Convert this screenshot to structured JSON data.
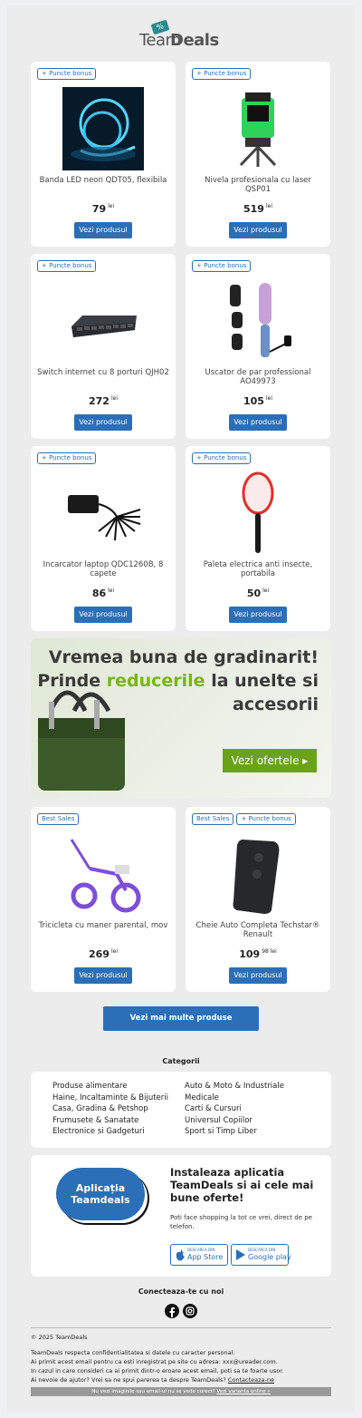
{
  "logo": {
    "brand_a": "Team",
    "brand_b": "Deals",
    "tag": "%"
  },
  "products": [
    {
      "badges": [
        "+ Puncte bonus"
      ],
      "name": "Banda LED neon QDT05, flexibila",
      "price": "79",
      "cents": "",
      "currency": "lei",
      "button": "Vezi produsul"
    },
    {
      "badges": [
        "+ Puncte bonus"
      ],
      "name": "Nivela profesionala cu laser QSP01",
      "price": "519",
      "cents": "",
      "currency": "lei",
      "button": "Vezi produsul"
    },
    {
      "badges": [
        "+ Puncte bonus"
      ],
      "name": "Switch internet cu 8 porturi QJH02",
      "price": "272",
      "cents": "",
      "currency": "lei",
      "button": "Vezi produsul"
    },
    {
      "badges": [
        "+ Puncte bonus"
      ],
      "name": "Uscator de par professional AO49973",
      "price": "105",
      "cents": "",
      "currency": "lei",
      "button": "Vezi produsul"
    },
    {
      "badges": [
        "+ Puncte bonus"
      ],
      "name": "Incarcator laptop QDC1260B, 8 capete",
      "price": "86",
      "cents": "",
      "currency": "lei",
      "button": "Vezi produsul"
    },
    {
      "badges": [
        "+ Puncte bonus"
      ],
      "name": "Paleta electrica anti insecte, portabila",
      "price": "50",
      "cents": "",
      "currency": "lei",
      "button": "Vezi produsul"
    },
    {
      "badges": [
        "Best Sales"
      ],
      "name": "Tricicleta cu maner parental, mov",
      "price": "269",
      "cents": "",
      "currency": "lei",
      "button": "Vezi produsul"
    },
    {
      "badges": [
        "Best Sales",
        "+ Puncte bonus"
      ],
      "name": "Cheie Auto Completa Techstar® Renault",
      "price": "109",
      "cents": "98",
      "currency": "lei",
      "button": "Vezi produsul"
    }
  ],
  "banner": {
    "line1": "Vremea buna de gradinarit!",
    "line2_a": "Prinde ",
    "line2_b": "reducerile",
    "line2_c": " la unelte si",
    "line3": "accesorii",
    "button": "Vezi ofertele ▸"
  },
  "more_button": "Vezi mai multe produse",
  "categories": {
    "title": "Categorii",
    "left": [
      "Produse alimentare",
      "Haine, Incaltaminte & Bijuterii",
      "Casa, Gradina & Petshop",
      "Frumusete & Sanatate",
      "Electronice si Gadgeturi"
    ],
    "right": [
      "Auto & Moto & Industriale",
      "Medicale",
      "Carti & Cursuri",
      "Universul Copiilor",
      "Sport si Timp Liber"
    ]
  },
  "app": {
    "pill_line1": "Aplicația",
    "pill_line2": "Teamdeals",
    "title": "Instaleaza aplicatia TeamDeals si ai cele mai bune oferte!",
    "desc": "Poti face shopping la tot ce vrei, direct de pe telefon.",
    "appstore_small": "DESCARCA DIN",
    "appstore": "App Store",
    "gplay_small": "DESCARCA DIN",
    "gplay": "Google play"
  },
  "social": {
    "title": "Conecteaza-te cu noi",
    "icons": [
      "facebook-icon",
      "instagram-icon"
    ]
  },
  "footer": {
    "copyright": "© 2025 TeamDeals",
    "line1": "TeamDeals respecta confidentialitatea si datele cu caracter personal.",
    "line2": "Ai primit acest email pentru ca esti inregistrat pe site cu adresa: xxx@ureader.com.",
    "line3": "In cazul in care consideri ca ai primit dintr-o eroare acest email, poti sa te foarte usor.",
    "line4": "Ai nevoie de ajutor? Vrei sa ne spui parerea ta despre TeamDeals?",
    "contact": "Contacteaza-ne",
    "bar_text": "Nu vezi imaginile sau email-ul nu se vede corect?",
    "bar_link": "Vezi varianta online »"
  },
  "colors": {
    "accent": "#2a6fb8",
    "green": "#78b51a",
    "background": "#ececec"
  }
}
